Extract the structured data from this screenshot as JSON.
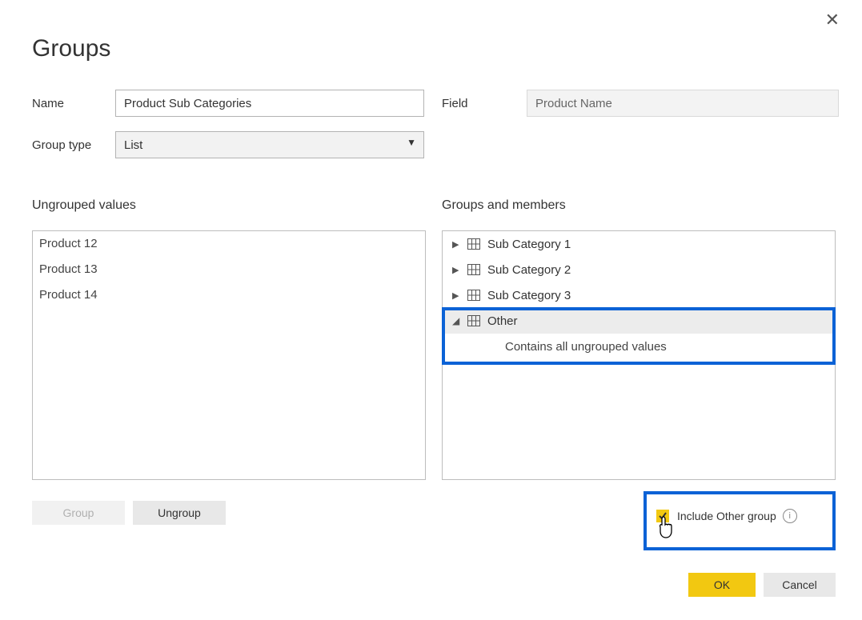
{
  "dialog": {
    "title": "Groups",
    "close": "✕"
  },
  "fields": {
    "name_label": "Name",
    "name_value": "Product Sub Categories",
    "field_label": "Field",
    "field_value": "Product Name",
    "group_type_label": "Group type",
    "group_type_value": "List"
  },
  "sections": {
    "ungrouped_label": "Ungrouped values",
    "groups_label": "Groups and members"
  },
  "ungrouped_items": [
    "Product 12",
    "Product 13",
    "Product 14"
  ],
  "groups": {
    "items": [
      {
        "label": "Sub Category 1"
      },
      {
        "label": "Sub Category 2"
      },
      {
        "label": "Sub Category 3"
      }
    ],
    "other_label": "Other",
    "other_desc": "Contains all ungrouped values"
  },
  "buttons": {
    "group": "Group",
    "ungroup": "Ungroup",
    "ok": "OK",
    "cancel": "Cancel"
  },
  "include_other": {
    "label": "Include Other group"
  }
}
